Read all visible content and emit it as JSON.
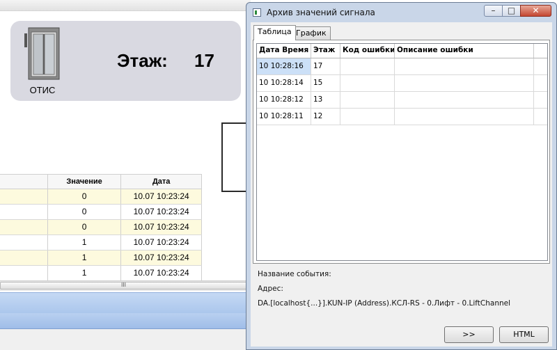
{
  "background": {
    "lift": {
      "name": "ОТИС",
      "floor_label": "Этаж:",
      "floor_value": "17"
    },
    "table": {
      "headers": [
        "",
        "Значение",
        "Дата"
      ],
      "rows": [
        [
          "",
          "0",
          "10.07 10:23:24"
        ],
        [
          "",
          "0",
          "10.07 10:23:24"
        ],
        [
          "",
          "0",
          "10.07 10:23:24"
        ],
        [
          "",
          "1",
          "10.07 10:23:24"
        ],
        [
          "",
          "1",
          "10.07 10:23:24"
        ],
        [
          "",
          "1",
          "10.07 10:23:24"
        ]
      ]
    },
    "scroll_grip": "III"
  },
  "window": {
    "title": "Архив значений сигнала",
    "controls": {
      "minimize": "–",
      "maximize": "□",
      "close": "✕"
    },
    "tabs": [
      {
        "label": "Таблица",
        "active": true
      },
      {
        "label": "График",
        "active": false
      }
    ],
    "grid": {
      "headers": [
        "Дата Время",
        "Этаж",
        "Код ошибки",
        "Описание ошибки"
      ],
      "rows": [
        [
          "10 10:28:16",
          "17",
          "",
          ""
        ],
        [
          "10 10:28:14",
          "15",
          "",
          ""
        ],
        [
          "10 10:28:12",
          "13",
          "",
          ""
        ],
        [
          "10 10:28:11",
          "12",
          "",
          ""
        ]
      ]
    },
    "event_name_label": "Название события:",
    "address_label": "Адрес:",
    "address_value": "DA.[localhost{...}].KUN-IP (Address).КСЛ-RS - 0.Лифт - 0.LiftChannel",
    "buttons": {
      "next": ">>",
      "html": "HTML"
    }
  },
  "icons": {
    "window-icon": "app-window-icon",
    "lift-icon": "elevator-icon"
  }
}
